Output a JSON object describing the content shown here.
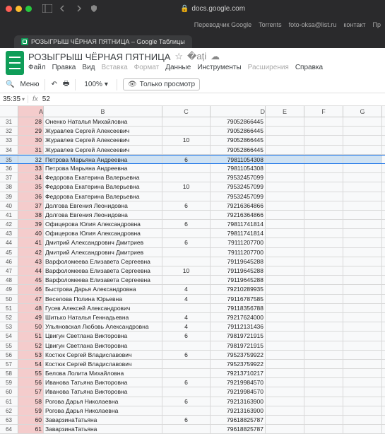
{
  "browser": {
    "url": "docs.google.com",
    "bookmarks": [
      "Переводчик Google",
      "Torrents",
      "foto-oksa@list.ru",
      "контакт",
      "Пр"
    ]
  },
  "tab": {
    "title": "РОЗЫГРЫШ ЧЁРНАЯ ПЯТНИЦА – Google Таблицы"
  },
  "doc": {
    "title": "РОЗЫГРЫШ ЧЁРНАЯ ПЯТНИЦА",
    "menus": [
      "Файл",
      "Правка",
      "Вид",
      "Вставка",
      "Формат",
      "Данные",
      "Инструменты",
      "Расширения",
      "Справка"
    ],
    "disabled_menus": [
      "Вставка",
      "Формат",
      "Расширения"
    ]
  },
  "toolbar": {
    "menu": "Меню",
    "zoom": "100%",
    "preview": "Только просмотр"
  },
  "namebox": {
    "ref": "35:35",
    "value": "52"
  },
  "columns": [
    "A",
    "B",
    "C",
    "D",
    "E",
    "F",
    "G"
  ],
  "col_widths": {
    "A": 36,
    "B": 168,
    "C": 68,
    "D": 78,
    "E": 55,
    "F": 55,
    "G": 55
  },
  "selected_row": 35,
  "chart_data": {
    "type": "table",
    "rows": [
      {
        "r": 31,
        "A": 28,
        "B": "Оненко Наталья Михайловна",
        "C": "",
        "D": "79052866445"
      },
      {
        "r": 32,
        "A": 29,
        "B": "Журавлев Сергей Алексеевич",
        "C": "",
        "D": "79052866445"
      },
      {
        "r": 33,
        "A": 30,
        "B": "Журавлев Сергей Алексеевич",
        "C": "10",
        "D": "79052866445"
      },
      {
        "r": 34,
        "A": 31,
        "B": "Журавлев Сергей Алексеевич",
        "C": "",
        "D": "79052866445"
      },
      {
        "r": 35,
        "A": 32,
        "B": "Петрова Марьяна Андреевна",
        "C": "6",
        "D": "79811054308"
      },
      {
        "r": 36,
        "A": 33,
        "B": "Петрова Марьяна Андреевна",
        "C": "",
        "D": "79811054308"
      },
      {
        "r": 37,
        "A": 34,
        "B": "Федорова Екатерина Валерьевна",
        "C": "",
        "D": "79532457099"
      },
      {
        "r": 38,
        "A": 35,
        "B": "Федорова Екатерина Валерьевна",
        "C": "10",
        "D": "79532457099"
      },
      {
        "r": 39,
        "A": 36,
        "B": "Федорова Екатерина Валерьевна",
        "C": "",
        "D": "79532457099"
      },
      {
        "r": 40,
        "A": 37,
        "B": "Долгова Евгения Леонидовна",
        "C": "6",
        "D": "79216364866"
      },
      {
        "r": 41,
        "A": 38,
        "B": "Долгова Евгения Леонидовна",
        "C": "",
        "D": "79216364866"
      },
      {
        "r": 42,
        "A": 39,
        "B": "Офицерова Юлия Александровна",
        "C": "6",
        "D": "79811741814"
      },
      {
        "r": 43,
        "A": 40,
        "B": "Офицерова Юлия Александровна",
        "C": "",
        "D": "79811741814"
      },
      {
        "r": 44,
        "A": 41,
        "B": "Дмитрий Александрович Дмитриев",
        "C": "6",
        "D": "79111207700"
      },
      {
        "r": 45,
        "A": 42,
        "B": "Дмитрий Александрович Дмитриев",
        "C": "",
        "D": "79111207700"
      },
      {
        "r": 46,
        "A": 43,
        "B": "Варфоломеева Елизавета Сергеевна",
        "C": "",
        "D": "79119645288"
      },
      {
        "r": 47,
        "A": 44,
        "B": "Варфоломеева Елизавета Сергеевна",
        "C": "10",
        "D": "79119645288"
      },
      {
        "r": 48,
        "A": 45,
        "B": "Варфоломеева Елизавета Сергеевна",
        "C": "",
        "D": "79119645288"
      },
      {
        "r": 49,
        "A": 46,
        "B": "Быстрова Дарья Александровна",
        "C": "4",
        "D": "79210289935"
      },
      {
        "r": 50,
        "A": 47,
        "B": "Веселова Полина Юрьевна",
        "C": "4",
        "D": "79116787585"
      },
      {
        "r": 51,
        "A": 48,
        "B": "Гусев Алексей Александрович",
        "C": "",
        "D": "79118356788"
      },
      {
        "r": 52,
        "A": 49,
        "B": "Шитько Наталья Геннадьевна",
        "C": "4",
        "D": "79217624000"
      },
      {
        "r": 53,
        "A": 50,
        "B": "Ульяновская Любовь Александровна",
        "C": "4",
        "D": "79112131436"
      },
      {
        "r": 54,
        "A": 51,
        "B": "Цвигун Светлана Викторовна",
        "C": "6",
        "D": "79819721915"
      },
      {
        "r": 55,
        "A": 52,
        "B": "Цвигун Светлана Викторовна",
        "C": "",
        "D": "79819721915"
      },
      {
        "r": 56,
        "A": 53,
        "B": "Костюк Сергей Владиславович",
        "C": "6",
        "D": "79523759922"
      },
      {
        "r": 57,
        "A": 54,
        "B": "Костюк Сергей Владиславович",
        "C": "",
        "D": "79523759922"
      },
      {
        "r": 58,
        "A": 55,
        "B": "Белова Лолита Михайловна",
        "C": "",
        "D": "79213710217"
      },
      {
        "r": 59,
        "A": 56,
        "B": "Иванова Татьяна Викторовна",
        "C": "6",
        "D": "79219984570"
      },
      {
        "r": 60,
        "A": 57,
        "B": "Иванова Татьяна Викторовна",
        "C": "",
        "D": "79219984570"
      },
      {
        "r": 61,
        "A": 58,
        "B": "Рогова Дарья Николаевна",
        "C": "6",
        "D": "79213163900"
      },
      {
        "r": 62,
        "A": 59,
        "B": "Рогова Дарья Николаевна",
        "C": "",
        "D": "79213163900"
      },
      {
        "r": 63,
        "A": 60,
        "B": "ЗаварзинаТатьяна",
        "C": "6",
        "D": "79618825787"
      },
      {
        "r": 64,
        "A": 61,
        "B": "ЗаварзинаТатьяна",
        "C": "",
        "D": "79618825787"
      }
    ]
  }
}
